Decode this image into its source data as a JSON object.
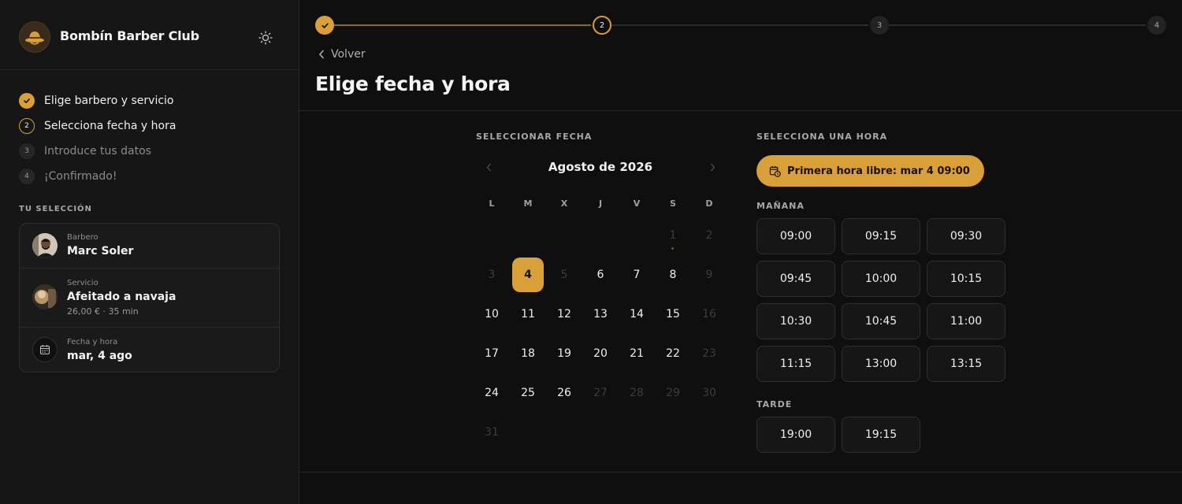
{
  "brand": {
    "name": "Bombín Barber Club"
  },
  "sidebar": {
    "steps": [
      {
        "label": "Elige barbero y servicio",
        "status": "done",
        "number": "1"
      },
      {
        "label": "Selecciona fecha y hora",
        "status": "current",
        "number": "2"
      },
      {
        "label": "Introduce tus datos",
        "status": "pending",
        "number": "3"
      },
      {
        "label": "¡Confirmado!",
        "status": "pending",
        "number": "4"
      }
    ],
    "selection_title": "TU SELECCIÓN",
    "selection": {
      "barber": {
        "caption": "Barbero",
        "value": "Marc Soler"
      },
      "service": {
        "caption": "Servicio",
        "value": "Afeitado a navaja",
        "detail": "26,00 € · 35 min"
      },
      "datetime": {
        "caption": "Fecha y hora",
        "value": "mar, 4 ago"
      }
    }
  },
  "progress": {
    "nodes": [
      "",
      "2",
      "3",
      "4"
    ],
    "current_step": 2
  },
  "main": {
    "back_label": "Volver",
    "title": "Elige fecha y hora",
    "date_section": "SELECCIONAR FECHA",
    "time_section": "SELECCIONA UNA HORA"
  },
  "calendar": {
    "month_label": "Agosto de 2026",
    "weekdays": [
      "L",
      "M",
      "X",
      "J",
      "V",
      "S",
      "D"
    ],
    "weeks": [
      [
        null,
        null,
        null,
        null,
        null,
        {
          "d": "1",
          "s": "disabled",
          "dot": true
        },
        {
          "d": "2",
          "s": "disabled"
        }
      ],
      [
        {
          "d": "3",
          "s": "disabled"
        },
        {
          "d": "4",
          "s": "selected"
        },
        {
          "d": "5",
          "s": "disabled"
        },
        {
          "d": "6",
          "s": "avail"
        },
        {
          "d": "7",
          "s": "avail"
        },
        {
          "d": "8",
          "s": "avail"
        },
        {
          "d": "9",
          "s": "disabled"
        }
      ],
      [
        {
          "d": "10",
          "s": "avail"
        },
        {
          "d": "11",
          "s": "avail"
        },
        {
          "d": "12",
          "s": "avail"
        },
        {
          "d": "13",
          "s": "avail"
        },
        {
          "d": "14",
          "s": "avail"
        },
        {
          "d": "15",
          "s": "avail"
        },
        {
          "d": "16",
          "s": "disabled"
        }
      ],
      [
        {
          "d": "17",
          "s": "avail"
        },
        {
          "d": "18",
          "s": "avail"
        },
        {
          "d": "19",
          "s": "avail"
        },
        {
          "d": "20",
          "s": "avail"
        },
        {
          "d": "21",
          "s": "avail"
        },
        {
          "d": "22",
          "s": "avail"
        },
        {
          "d": "23",
          "s": "disabled"
        }
      ],
      [
        {
          "d": "24",
          "s": "avail"
        },
        {
          "d": "25",
          "s": "avail"
        },
        {
          "d": "26",
          "s": "avail"
        },
        {
          "d": "27",
          "s": "disabled"
        },
        {
          "d": "28",
          "s": "disabled"
        },
        {
          "d": "29",
          "s": "disabled"
        },
        {
          "d": "30",
          "s": "disabled"
        }
      ],
      [
        {
          "d": "31",
          "s": "disabled"
        },
        null,
        null,
        null,
        null,
        null,
        null
      ]
    ]
  },
  "times": {
    "first_free_label": "Primera hora libre: mar 4 09:00",
    "morning_label": "MAÑANA",
    "morning": [
      "09:00",
      "09:15",
      "09:30",
      "09:45",
      "10:00",
      "10:15",
      "10:30",
      "10:45",
      "11:00",
      "11:15",
      "13:00",
      "13:15"
    ],
    "afternoon_label": "TARDE",
    "afternoon": [
      "19:00",
      "19:15"
    ]
  },
  "colors": {
    "accent": "#d9a03a",
    "background": "#0f0f0f",
    "sidebar": "#161616"
  },
  "icons": {
    "theme": "sun-icon",
    "back": "chevron-left-icon",
    "first_free": "calendar-clock-icon"
  }
}
